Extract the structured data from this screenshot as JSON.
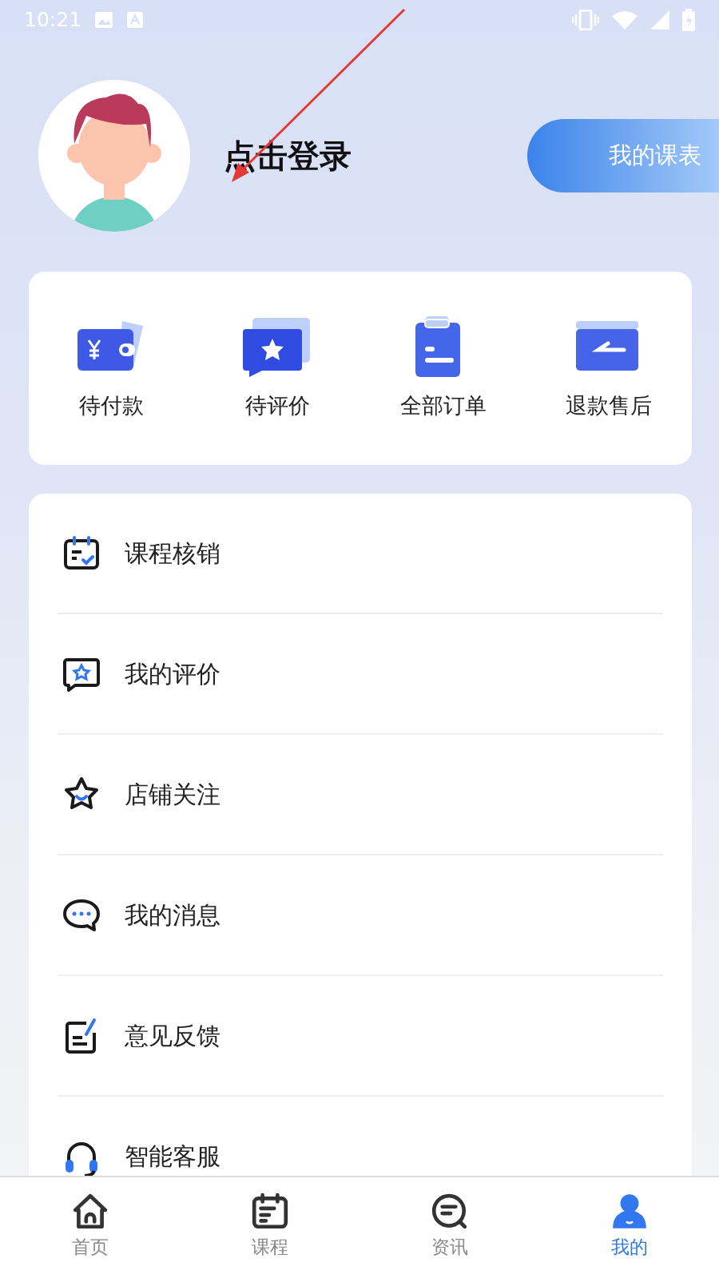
{
  "status_bar": {
    "time": "10:21"
  },
  "profile": {
    "login_text": "点击登录",
    "schedule_button": "我的课表"
  },
  "orders": [
    {
      "kind": "wallet",
      "label": "待付款"
    },
    {
      "kind": "review",
      "label": "待评价"
    },
    {
      "kind": "orders",
      "label": "全部订单"
    },
    {
      "kind": "refund",
      "label": "退款售后"
    }
  ],
  "menu": [
    {
      "kind": "checkin",
      "label": "课程核销"
    },
    {
      "kind": "review",
      "label": "我的评价"
    },
    {
      "kind": "favorite",
      "label": "店铺关注"
    },
    {
      "kind": "message",
      "label": "我的消息"
    },
    {
      "kind": "feedback",
      "label": "意见反馈"
    },
    {
      "kind": "service",
      "label": "智能客服"
    }
  ],
  "tab_bar": [
    {
      "kind": "home",
      "label": "首页",
      "selected": false
    },
    {
      "kind": "course",
      "label": "课程",
      "selected": false
    },
    {
      "kind": "news",
      "label": "资讯",
      "selected": false
    },
    {
      "kind": "profile",
      "label": "我的",
      "selected": true
    }
  ]
}
